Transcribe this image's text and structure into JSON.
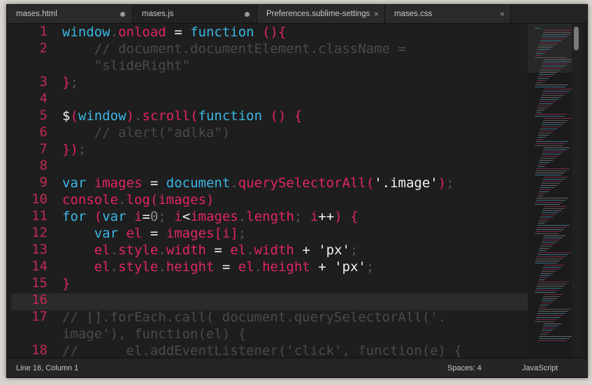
{
  "tabs": [
    {
      "label": "mases.html",
      "marker": "dot"
    },
    {
      "label": "mases.js",
      "marker": "dot"
    },
    {
      "label": "Preferences.sublime-settings",
      "marker": "×"
    },
    {
      "label": "mases.css",
      "marker": "×"
    }
  ],
  "active_tab": "mases.js",
  "line_numbers": [
    "1",
    "2",
    "3",
    "4",
    "5",
    "6",
    "7",
    "8",
    "9",
    "10",
    "11",
    "12",
    "13",
    "14",
    "15",
    "16",
    "17",
    "18"
  ],
  "code_lines": [
    "window.onload = function (){",
    "    // document.documentElement.className =",
    "    \"slideRight\"",
    "};",
    "",
    "$(window).scroll(function () {",
    "    // alert(\"adlka\")",
    "});",
    "",
    "var images = document.querySelectorAll('.image');",
    "console.log(images)",
    "for (var i=0; i<images.length; i++) {",
    "    var el = images[i];",
    "    el.style.width = el.width + 'px';",
    "    el.style.height = el.height + 'px';",
    "}",
    "",
    "// [].forEach.call( document.querySelectorAll('.",
    "image'), function(el) {",
    "//      el.addEventListener('click', function(e) {"
  ],
  "status": {
    "position": "Line 16, Column 1",
    "indent": "Spaces: 4",
    "syntax": "JavaScript"
  },
  "colors": {
    "accent_pink": "#e0246a",
    "accent_blue": "#3bb7e6",
    "background": "#1e1e1e"
  }
}
